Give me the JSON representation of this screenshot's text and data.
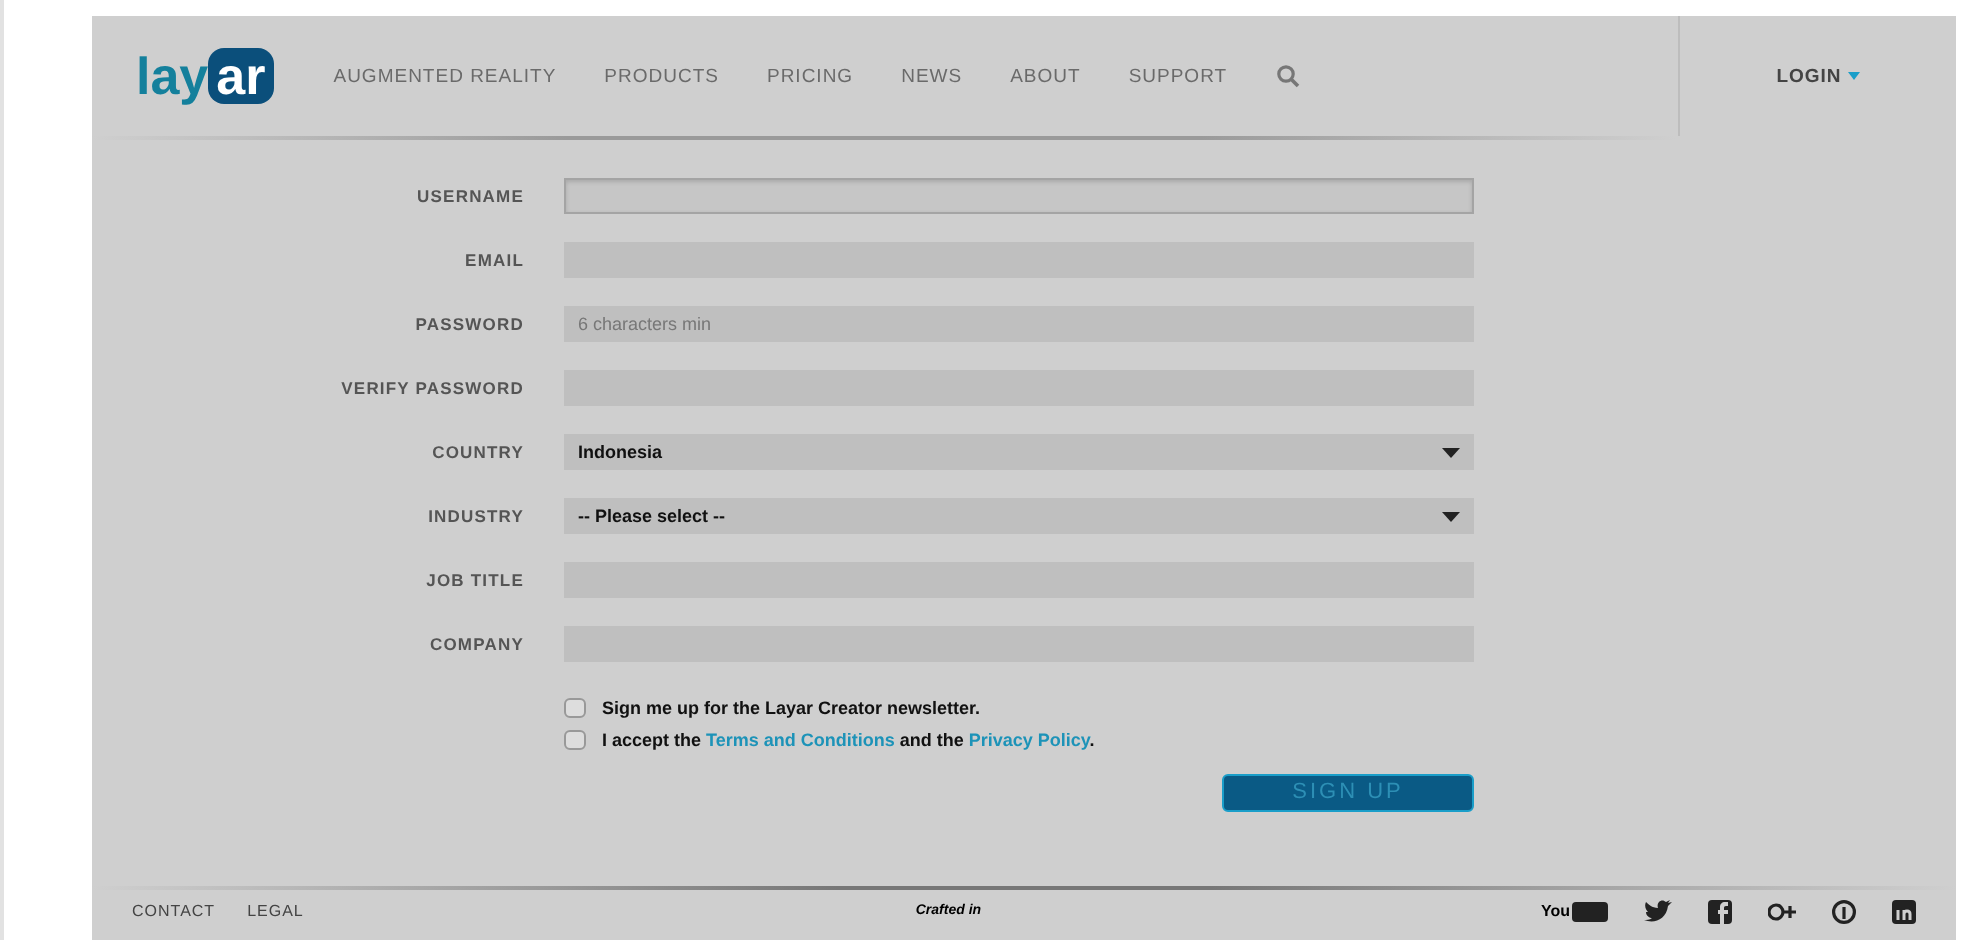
{
  "header": {
    "logo": {
      "plain": "lay",
      "badge": "ar"
    },
    "nav": [
      {
        "label": "AUGMENTED REALITY"
      },
      {
        "label": "PRODUCTS"
      },
      {
        "label": "PRICING"
      },
      {
        "label": "NEWS"
      },
      {
        "label": "ABOUT"
      },
      {
        "label": "SUPPORT"
      }
    ],
    "login": "LOGIN"
  },
  "form": {
    "fields": [
      {
        "label": "USERNAME",
        "kind": "text",
        "focused": true
      },
      {
        "label": "EMAIL",
        "kind": "text",
        "focused": false
      },
      {
        "label": "PASSWORD",
        "kind": "text",
        "focused": false,
        "placeholder": "6 characters min"
      },
      {
        "label": "VERIFY PASSWORD",
        "kind": "text",
        "focused": false
      },
      {
        "label": "COUNTRY",
        "kind": "select",
        "focused": false,
        "value": "Indonesia"
      },
      {
        "label": "INDUSTRY",
        "kind": "select",
        "focused": false,
        "value": "-- Please select --"
      },
      {
        "label": "JOB TITLE",
        "kind": "text",
        "focused": false
      },
      {
        "label": "COMPANY",
        "kind": "text",
        "focused": false
      }
    ],
    "checks": [
      {
        "checked": false,
        "parts": [
          {
            "kind": "text",
            "text": "Sign me up for the Layar Creator newsletter."
          }
        ]
      },
      {
        "checked": false,
        "parts": [
          {
            "kind": "text",
            "text": "I accept the "
          },
          {
            "kind": "link",
            "text": "Terms and Conditions"
          },
          {
            "kind": "text",
            "text": " and the "
          },
          {
            "kind": "link",
            "text": "Privacy Policy"
          },
          {
            "kind": "text",
            "text": "."
          }
        ]
      }
    ],
    "submit": "SIGN UP"
  },
  "footer": {
    "links": [
      {
        "label": "CONTACT"
      },
      {
        "label": "LEGAL"
      }
    ],
    "crafted": "Crafted in",
    "youtube": "You"
  }
}
